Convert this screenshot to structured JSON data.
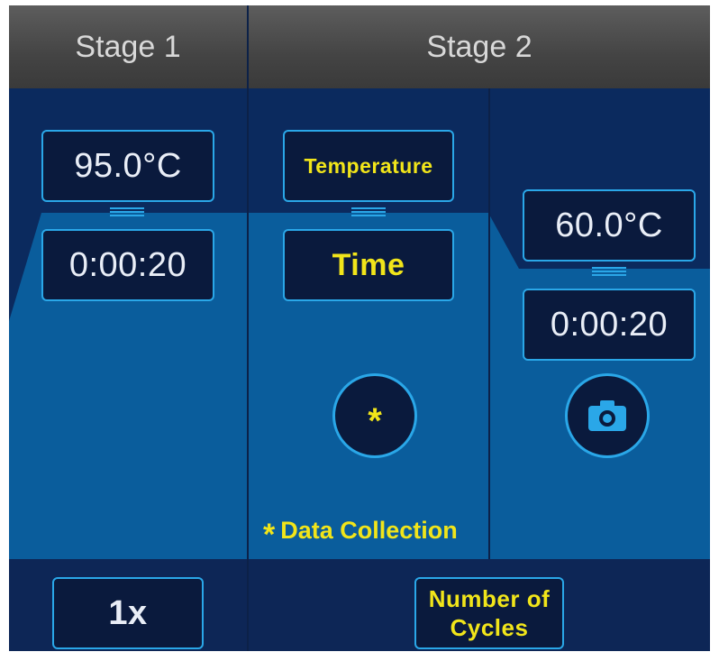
{
  "stages": [
    {
      "title": "Stage 1"
    },
    {
      "title": "Stage 2"
    }
  ],
  "stage1": {
    "temperature": "95.0°C",
    "time": "0:00:20"
  },
  "stage2_step1": {
    "temperature_label": "Temperature",
    "time_label": "Time",
    "data_collection_symbol": "*"
  },
  "stage2_step2": {
    "temperature": "60.0°C",
    "time": "0:00:20"
  },
  "legend": {
    "symbol": "*",
    "text": "Data Collection"
  },
  "footer": {
    "stage1_cycles": "1x",
    "stage2_cycles_label": "Number of Cycles"
  },
  "icons": {
    "data_collection_off": "asterisk-icon",
    "data_collection_on": "camera-icon",
    "hold_line": "ramp-handle-icon"
  },
  "colors": {
    "screen_bg": "#0f2a5c",
    "plot_fill": "#0a5d9c",
    "header_bg": "#4a4a4a",
    "field_border": "#2aa7e8",
    "field_bg": "#0a1a3d",
    "accent_yellow": "#f1e51a",
    "text": "#e9eef7"
  }
}
